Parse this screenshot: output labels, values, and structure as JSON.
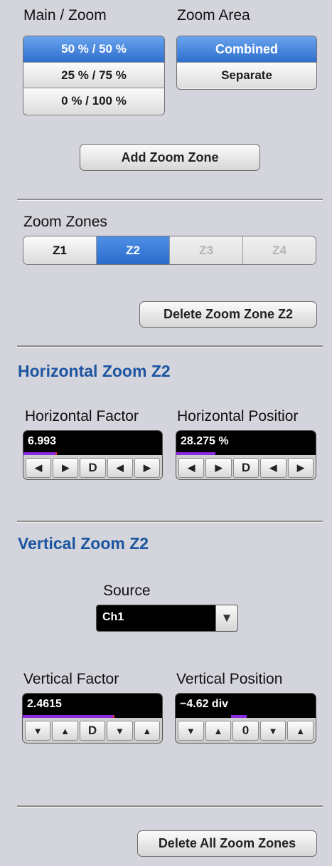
{
  "main_zoom": {
    "title": "Main / Zoom",
    "options": [
      "50 % / 50 %",
      "25 % / 75 %",
      "0 % / 100 %"
    ],
    "selected": "50 % / 50 %"
  },
  "zoom_area": {
    "title": "Zoom Area",
    "options": [
      "Combined",
      "Separate"
    ],
    "selected": "Combined"
  },
  "add_zoom_zone_label": "Add Zoom Zone",
  "zoom_zones": {
    "title": "Zoom Zones",
    "tabs": [
      {
        "label": "Z1",
        "state": "normal"
      },
      {
        "label": "Z2",
        "state": "active"
      },
      {
        "label": "Z3",
        "state": "disabled"
      },
      {
        "label": "Z4",
        "state": "disabled"
      }
    ]
  },
  "delete_zone_label": "Delete Zoom Zone Z2",
  "horizontal": {
    "title": "Horizontal Zoom Z2",
    "factor": {
      "label": "Horizontal Factor",
      "value": "6.993",
      "level_fraction": 0.23,
      "buttons": [
        "◀",
        "▶",
        "D",
        "◀",
        "▶"
      ]
    },
    "position": {
      "label": "Horizontal Positior",
      "value": "28.275 %",
      "level_fraction": 0.28,
      "buttons": [
        "◀",
        "▶",
        "D",
        "◀",
        "▶"
      ]
    }
  },
  "vertical": {
    "title": "Vertical Zoom Z2",
    "source": {
      "label": "Source",
      "value": "Ch1",
      "arrow": "▼"
    },
    "factor": {
      "label": "Vertical Factor",
      "value": "2.4615",
      "level_fraction": 0.65,
      "buttons": [
        "▼",
        "▲",
        "D",
        "▼",
        "▲"
      ]
    },
    "position": {
      "label": "Vertical Position",
      "value": "−4.62 div",
      "level_fraction": 0.0,
      "buttons": [
        "▼",
        "▲",
        "0",
        "▼",
        "▲"
      ]
    }
  },
  "delete_all_label": "Delete All Zoom Zones",
  "colors": {
    "background": "#d4d4dc",
    "accent_blue": "#2f6fcf",
    "section_title": "#1c55a0",
    "level_bar": "#8a2be2"
  }
}
